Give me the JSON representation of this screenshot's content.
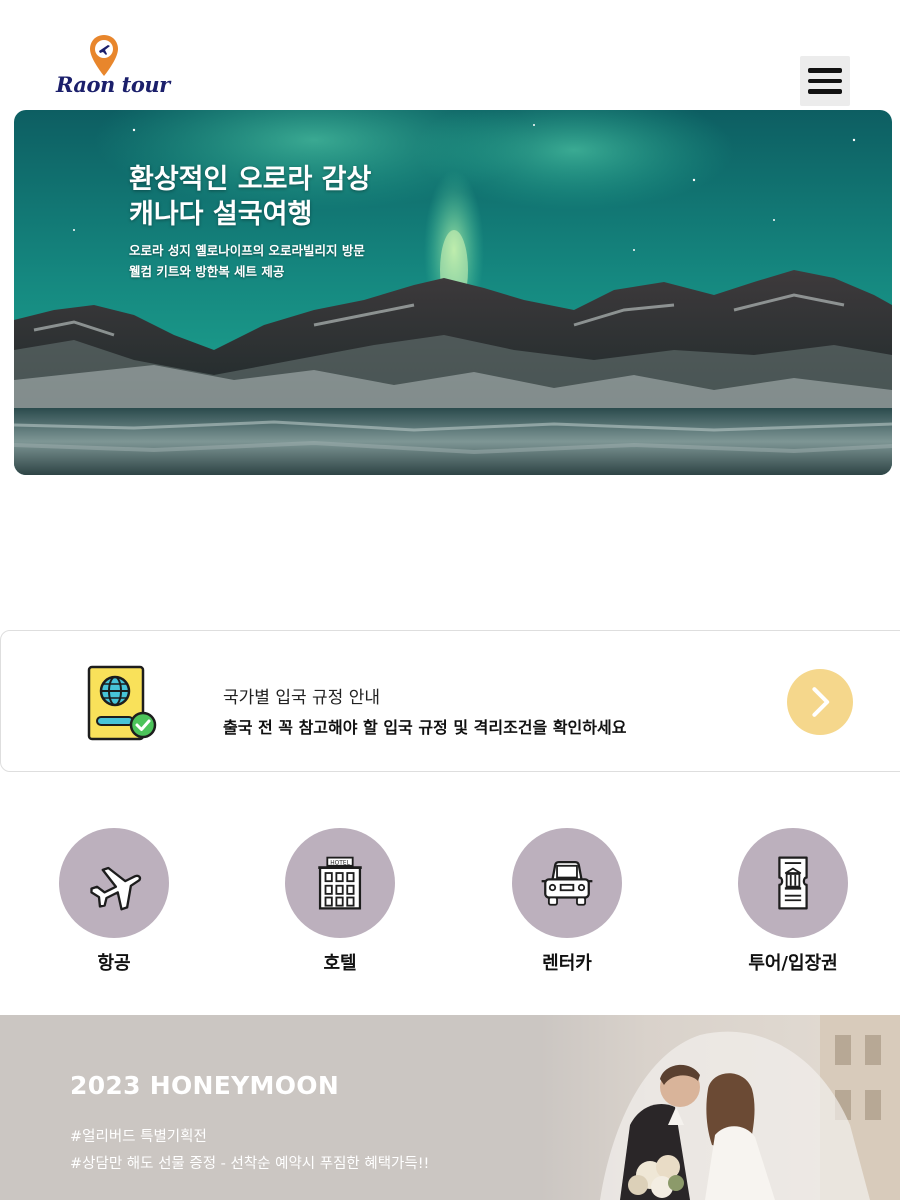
{
  "header": {
    "logo_text": "Raon tour",
    "menu_icon": "hamburger-icon"
  },
  "hero": {
    "title_line1": "환상적인 오로라 감상",
    "title_line2": "캐나다 설국여행",
    "sub_line1": "오로라 성지 옐로나이프의 오로라빌리지 방문",
    "sub_line2": "웰컴 키트와 방한복 세트 제공"
  },
  "entry_info": {
    "icon": "passport-icon",
    "title": "국가별 입국 규정 안내",
    "description": "출국 전 꼭 참고해야 할 입국 규정 및 격리조건을 확인하세요",
    "arrow_icon": "chevron-right-icon",
    "accent_color": "#f5d78c"
  },
  "categories": {
    "circle_color": "#bcb0bd",
    "items": [
      {
        "label": "항공",
        "icon": "airplane-icon"
      },
      {
        "label": "호텔",
        "icon": "hotel-icon"
      },
      {
        "label": "렌터카",
        "icon": "car-icon"
      },
      {
        "label": "투어/입장권",
        "icon": "ticket-icon"
      }
    ]
  },
  "honeymoon": {
    "title": "2023 HONEYMOON",
    "line1": "#얼리버드 특별기획전",
    "line2": "#상담만 해도 선물 증정 - 선착순 예약시 푸짐한 혜택가득!!"
  }
}
